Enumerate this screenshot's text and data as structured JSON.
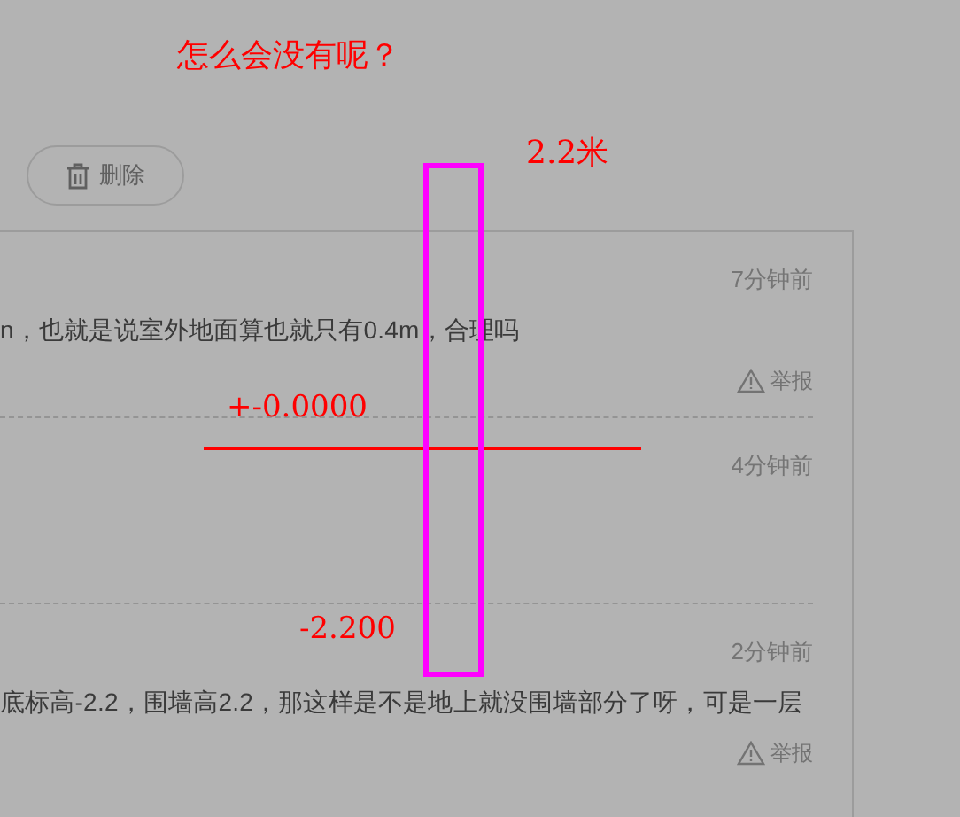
{
  "delete_button": {
    "label": "删除"
  },
  "comments": [
    {
      "time": "7分钟前",
      "text": "n，也就是说室外地面算也就只有0.4m，合理吗",
      "report": "举报"
    },
    {
      "time": "4分钟前"
    },
    {
      "time": "2分钟前",
      "text": "底标高-2.2，围墙高2.2，那这样是不是地上就没围墙部分了呀，可是一层",
      "report": "举报"
    }
  ],
  "annotations": {
    "question": "怎么会没有呢？",
    "height_label": "2.2米",
    "top_elevation": "+-0.0000",
    "bottom_elevation": "-2.200"
  }
}
